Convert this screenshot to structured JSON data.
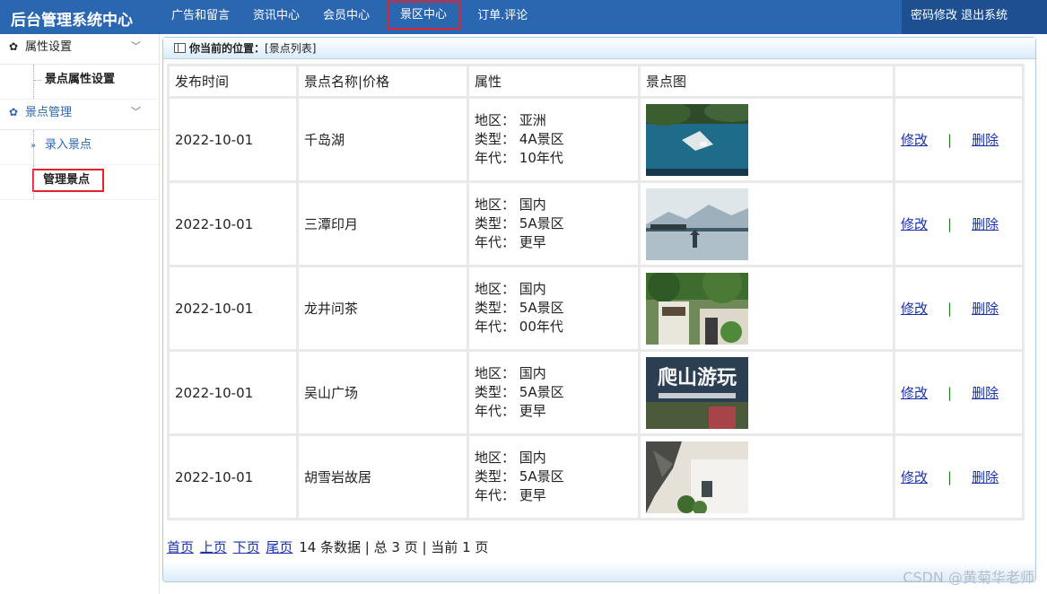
{
  "header": {
    "logo": "后台管理系统中心",
    "nav": [
      "广告和留言",
      "资讯中心",
      "会员中心",
      "景区中心",
      "订单.评论"
    ],
    "change_password": "密码修改",
    "logout": "退出系统"
  },
  "sidebar": {
    "group1": {
      "label": "属性设置",
      "items": [
        "景点属性设置"
      ]
    },
    "group2": {
      "label": "景点管理",
      "items": [
        "录入景点",
        "管理景点"
      ]
    }
  },
  "breadcrumb": {
    "label": "你当前的位置：",
    "current": "[景点列表]"
  },
  "table": {
    "headers": [
      "发布时间",
      "景点名称|价格",
      "属性",
      "景点图",
      ""
    ],
    "attr_labels": {
      "region": "地区：",
      "type": "类型：",
      "era": "年代："
    },
    "edit_label": "修改",
    "separator": "|",
    "delete_label": "删除",
    "rows": [
      {
        "date": "2022-10-01",
        "name": "千岛湖",
        "region": "亚洲",
        "type": "4A景区",
        "era": "10年代",
        "image": "lake-islands-photo"
      },
      {
        "date": "2022-10-01",
        "name": "三潭印月",
        "region": "国内",
        "type": "5A景区",
        "era": "更早",
        "image": "west-lake-pagodas-photo"
      },
      {
        "date": "2022-10-01",
        "name": "龙井问茶",
        "region": "国内",
        "type": "5A景区",
        "era": "00年代",
        "image": "tea-house-gate-photo"
      },
      {
        "date": "2022-10-01",
        "name": "吴山广场",
        "region": "国内",
        "type": "5A景区",
        "era": "更早",
        "image": "wushan-calligraphy-photo"
      },
      {
        "date": "2022-10-01",
        "name": "胡雪岩故居",
        "region": "国内",
        "type": "5A景区",
        "era": "更早",
        "image": "old-residence-photo"
      }
    ]
  },
  "pager": {
    "first": "首页",
    "prev": "上页",
    "next": "下页",
    "last": "尾页",
    "summary": "14 条数据 | 总 3 页 | 当前 1 页"
  },
  "watermark": "CSDN @黄菊华老师",
  "thumb_text": "爬山游玩"
}
